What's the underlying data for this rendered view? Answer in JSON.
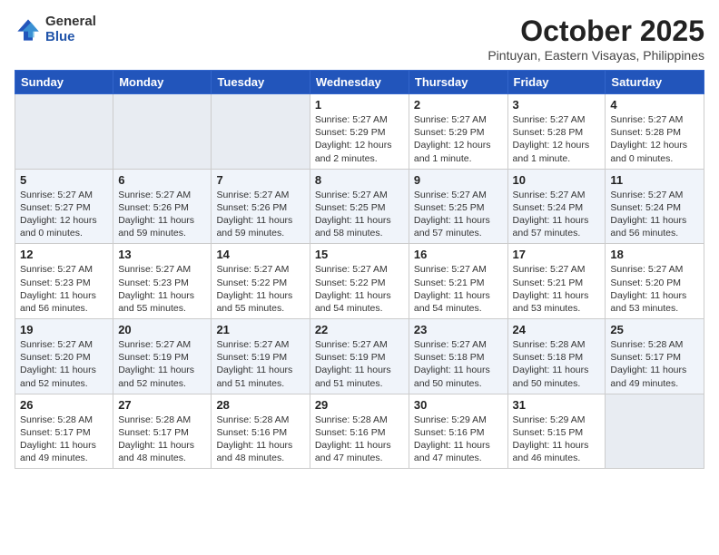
{
  "logo": {
    "general": "General",
    "blue": "Blue"
  },
  "header": {
    "month": "October 2025",
    "location": "Pintuyan, Eastern Visayas, Philippines"
  },
  "weekdays": [
    "Sunday",
    "Monday",
    "Tuesday",
    "Wednesday",
    "Thursday",
    "Friday",
    "Saturday"
  ],
  "weeks": [
    [
      {
        "day": "",
        "info": ""
      },
      {
        "day": "",
        "info": ""
      },
      {
        "day": "",
        "info": ""
      },
      {
        "day": "1",
        "info": "Sunrise: 5:27 AM\nSunset: 5:29 PM\nDaylight: 12 hours\nand 2 minutes."
      },
      {
        "day": "2",
        "info": "Sunrise: 5:27 AM\nSunset: 5:29 PM\nDaylight: 12 hours\nand 1 minute."
      },
      {
        "day": "3",
        "info": "Sunrise: 5:27 AM\nSunset: 5:28 PM\nDaylight: 12 hours\nand 1 minute."
      },
      {
        "day": "4",
        "info": "Sunrise: 5:27 AM\nSunset: 5:28 PM\nDaylight: 12 hours\nand 0 minutes."
      }
    ],
    [
      {
        "day": "5",
        "info": "Sunrise: 5:27 AM\nSunset: 5:27 PM\nDaylight: 12 hours\nand 0 minutes."
      },
      {
        "day": "6",
        "info": "Sunrise: 5:27 AM\nSunset: 5:26 PM\nDaylight: 11 hours\nand 59 minutes."
      },
      {
        "day": "7",
        "info": "Sunrise: 5:27 AM\nSunset: 5:26 PM\nDaylight: 11 hours\nand 59 minutes."
      },
      {
        "day": "8",
        "info": "Sunrise: 5:27 AM\nSunset: 5:25 PM\nDaylight: 11 hours\nand 58 minutes."
      },
      {
        "day": "9",
        "info": "Sunrise: 5:27 AM\nSunset: 5:25 PM\nDaylight: 11 hours\nand 57 minutes."
      },
      {
        "day": "10",
        "info": "Sunrise: 5:27 AM\nSunset: 5:24 PM\nDaylight: 11 hours\nand 57 minutes."
      },
      {
        "day": "11",
        "info": "Sunrise: 5:27 AM\nSunset: 5:24 PM\nDaylight: 11 hours\nand 56 minutes."
      }
    ],
    [
      {
        "day": "12",
        "info": "Sunrise: 5:27 AM\nSunset: 5:23 PM\nDaylight: 11 hours\nand 56 minutes."
      },
      {
        "day": "13",
        "info": "Sunrise: 5:27 AM\nSunset: 5:23 PM\nDaylight: 11 hours\nand 55 minutes."
      },
      {
        "day": "14",
        "info": "Sunrise: 5:27 AM\nSunset: 5:22 PM\nDaylight: 11 hours\nand 55 minutes."
      },
      {
        "day": "15",
        "info": "Sunrise: 5:27 AM\nSunset: 5:22 PM\nDaylight: 11 hours\nand 54 minutes."
      },
      {
        "day": "16",
        "info": "Sunrise: 5:27 AM\nSunset: 5:21 PM\nDaylight: 11 hours\nand 54 minutes."
      },
      {
        "day": "17",
        "info": "Sunrise: 5:27 AM\nSunset: 5:21 PM\nDaylight: 11 hours\nand 53 minutes."
      },
      {
        "day": "18",
        "info": "Sunrise: 5:27 AM\nSunset: 5:20 PM\nDaylight: 11 hours\nand 53 minutes."
      }
    ],
    [
      {
        "day": "19",
        "info": "Sunrise: 5:27 AM\nSunset: 5:20 PM\nDaylight: 11 hours\nand 52 minutes."
      },
      {
        "day": "20",
        "info": "Sunrise: 5:27 AM\nSunset: 5:19 PM\nDaylight: 11 hours\nand 52 minutes."
      },
      {
        "day": "21",
        "info": "Sunrise: 5:27 AM\nSunset: 5:19 PM\nDaylight: 11 hours\nand 51 minutes."
      },
      {
        "day": "22",
        "info": "Sunrise: 5:27 AM\nSunset: 5:19 PM\nDaylight: 11 hours\nand 51 minutes."
      },
      {
        "day": "23",
        "info": "Sunrise: 5:27 AM\nSunset: 5:18 PM\nDaylight: 11 hours\nand 50 minutes."
      },
      {
        "day": "24",
        "info": "Sunrise: 5:28 AM\nSunset: 5:18 PM\nDaylight: 11 hours\nand 50 minutes."
      },
      {
        "day": "25",
        "info": "Sunrise: 5:28 AM\nSunset: 5:17 PM\nDaylight: 11 hours\nand 49 minutes."
      }
    ],
    [
      {
        "day": "26",
        "info": "Sunrise: 5:28 AM\nSunset: 5:17 PM\nDaylight: 11 hours\nand 49 minutes."
      },
      {
        "day": "27",
        "info": "Sunrise: 5:28 AM\nSunset: 5:17 PM\nDaylight: 11 hours\nand 48 minutes."
      },
      {
        "day": "28",
        "info": "Sunrise: 5:28 AM\nSunset: 5:16 PM\nDaylight: 11 hours\nand 48 minutes."
      },
      {
        "day": "29",
        "info": "Sunrise: 5:28 AM\nSunset: 5:16 PM\nDaylight: 11 hours\nand 47 minutes."
      },
      {
        "day": "30",
        "info": "Sunrise: 5:29 AM\nSunset: 5:16 PM\nDaylight: 11 hours\nand 47 minutes."
      },
      {
        "day": "31",
        "info": "Sunrise: 5:29 AM\nSunset: 5:15 PM\nDaylight: 11 hours\nand 46 minutes."
      },
      {
        "day": "",
        "info": ""
      }
    ]
  ]
}
